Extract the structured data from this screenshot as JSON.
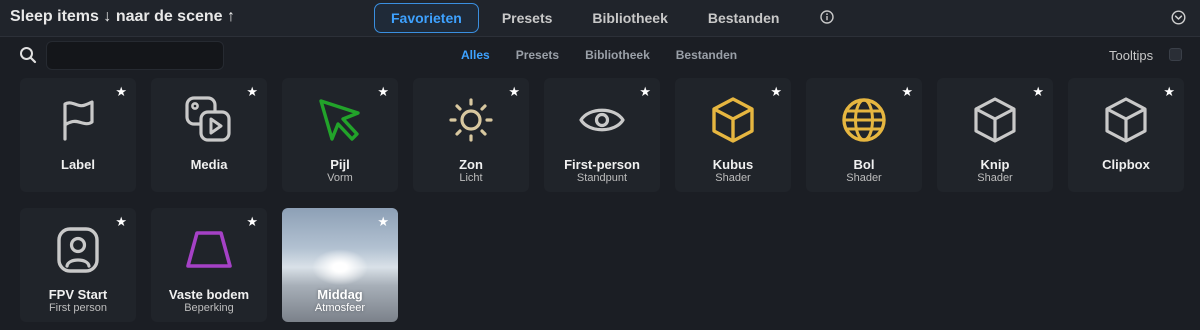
{
  "header": {
    "title": "Sleep items ↓ naar de scene ↑",
    "tabs": [
      "Favorieten",
      "Presets",
      "Bibliotheek",
      "Bestanden"
    ],
    "active_tab": "Favorieten",
    "info_icon": "info-icon",
    "collapse_icon": "chevron-down-circle-icon"
  },
  "filter": {
    "search_placeholder": "",
    "search_value": "",
    "tabs": [
      "Alles",
      "Presets",
      "Bibliotheek",
      "Bestanden"
    ],
    "active_tab": "Alles",
    "tooltips_label": "Tooltips",
    "tooltips_checked": false
  },
  "colors": {
    "accent": "#3ea2ff",
    "cursor_green": "#22a32a",
    "gold": "#e6b640",
    "purple": "#a541c6",
    "icon_grey": "#c9c9c9",
    "sun": "#d8c8a0"
  },
  "items": [
    {
      "name": "Label",
      "sub": "",
      "icon": "flag-icon",
      "star": "★"
    },
    {
      "name": "Media",
      "sub": "",
      "icon": "media-icon",
      "star": "★"
    },
    {
      "name": "Pijl",
      "sub": "Vorm",
      "icon": "cursor-arrow-icon",
      "star": "★"
    },
    {
      "name": "Zon",
      "sub": "Licht",
      "icon": "sun-icon",
      "star": "★"
    },
    {
      "name": "First-person",
      "sub": "Standpunt",
      "icon": "eye-icon",
      "star": "★"
    },
    {
      "name": "Kubus",
      "sub": "Shader",
      "icon": "cube-icon",
      "star": "★"
    },
    {
      "name": "Bol",
      "sub": "Shader",
      "icon": "globe-icon",
      "star": "★"
    },
    {
      "name": "Knip",
      "sub": "Shader",
      "icon": "cube-outline-icon",
      "star": "★"
    },
    {
      "name": "Clipbox",
      "sub": "",
      "icon": "cube-outline-icon",
      "star": "★"
    },
    {
      "name": "FPV Start",
      "sub": "First person",
      "icon": "user-badge-icon",
      "star": "★"
    },
    {
      "name": "Vaste bodem",
      "sub": "Beperking",
      "icon": "trapezoid-icon",
      "star": "★"
    },
    {
      "name": "Middag",
      "sub": "Atmosfeer",
      "icon": "sky-thumbnail",
      "star": "★"
    }
  ]
}
